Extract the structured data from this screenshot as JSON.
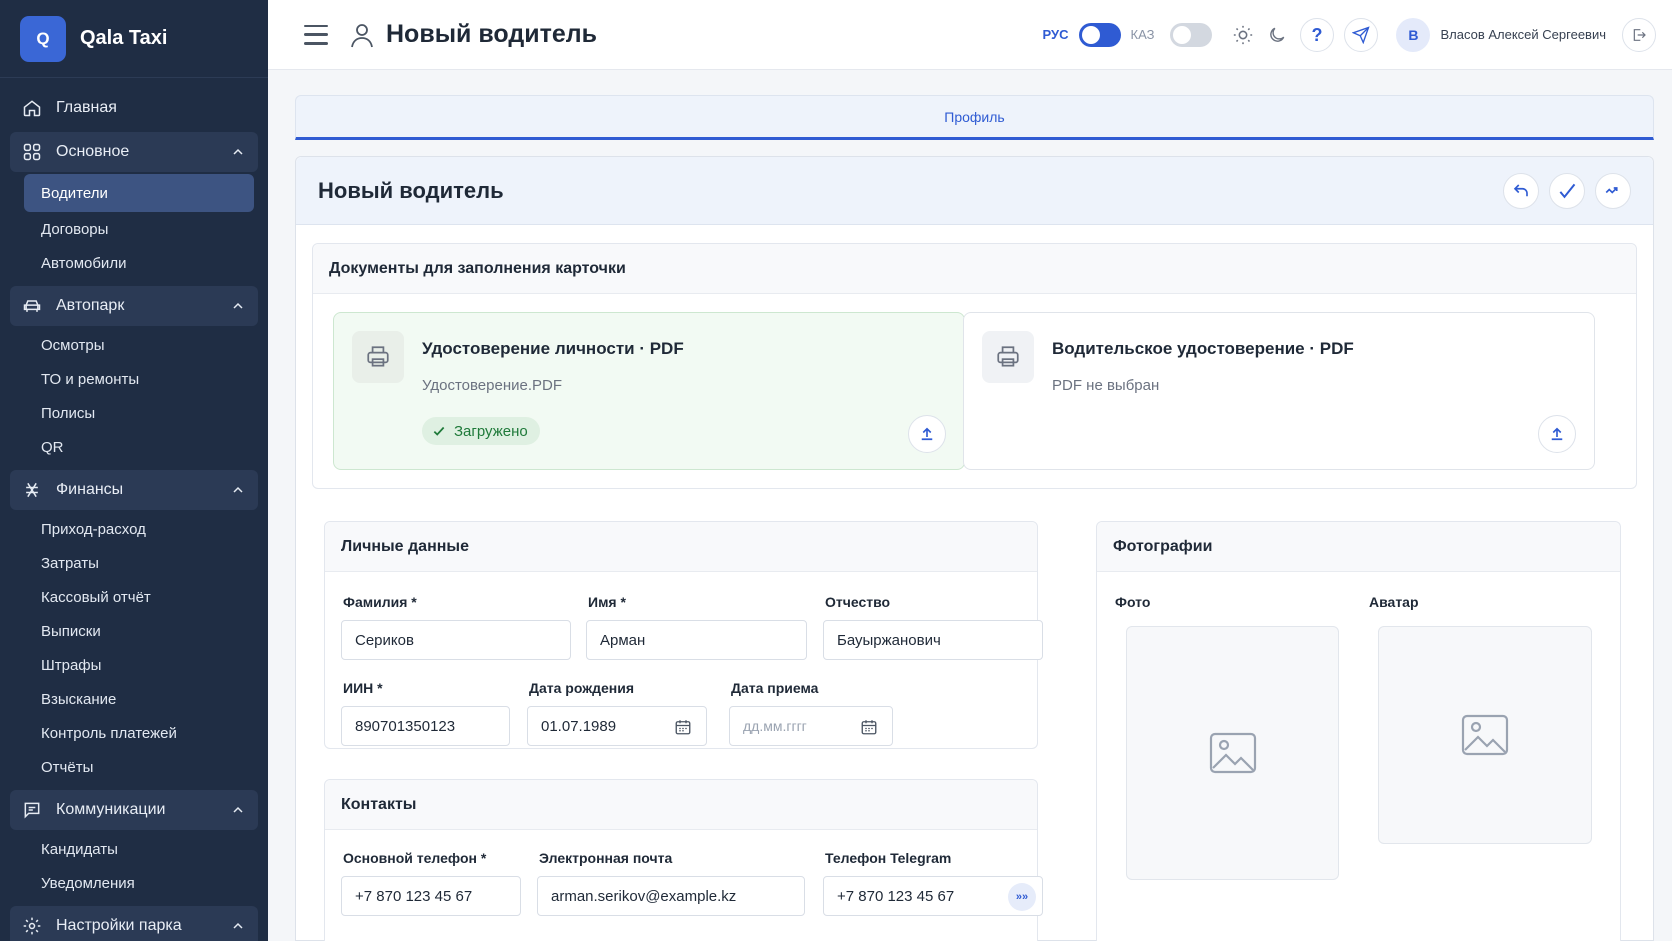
{
  "brand": {
    "logo_letter": "Q",
    "name": "Qala Taxi"
  },
  "sidebar": {
    "home": {
      "label": "Главная",
      "icon": "home-icon"
    },
    "groups": [
      {
        "label": "Основное",
        "icon": "grid-icon",
        "items": [
          "Водители",
          "Договоры",
          "Автомобили"
        ],
        "active": "Водители"
      },
      {
        "label": "Автопарк",
        "icon": "car-icon",
        "items": [
          "Осмотры",
          "ТО и ремонты",
          "Полисы",
          "QR"
        ]
      },
      {
        "label": "Финансы",
        "icon": "finance-icon",
        "items": [
          "Приход-расход",
          "Затраты",
          "Кассовый отчёт",
          "Выписки",
          "Штрафы",
          "Взыскание",
          "Контроль платежей",
          "Отчёты"
        ]
      },
      {
        "label": "Коммуникации",
        "icon": "chat-icon",
        "items": [
          "Кандидаты",
          "Уведомления"
        ]
      },
      {
        "label": "Настройки парка",
        "icon": "gear-icon",
        "items": []
      }
    ]
  },
  "header": {
    "title": "Новый водитель",
    "lang_ru": "РУС",
    "lang_kz": "КАЗ",
    "lang_toggle_on": true,
    "theme_toggle_on": false,
    "user_initial": "В",
    "user_name": "Власов Алексей Сергеевич"
  },
  "tabs": [
    {
      "label": "Профиль",
      "active": true
    }
  ],
  "card": {
    "title": "Новый водитель"
  },
  "documents": {
    "title": "Документы для заполнения карточки",
    "items": [
      {
        "title": "Удостоверение личности · PDF",
        "file": "Удостоверение.PDF",
        "status": "Загружено",
        "uploaded": true
      },
      {
        "title": "Водительское удостоверение · PDF",
        "file": "PDF не выбран",
        "status": "",
        "uploaded": false
      }
    ]
  },
  "personal": {
    "title": "Личные данные",
    "last_name": {
      "label": "Фамилия *",
      "value": "Сериков"
    },
    "first_name": {
      "label": "Имя *",
      "value": "Арман"
    },
    "middle_name": {
      "label": "Отчество",
      "value": "Бауыржанович"
    },
    "iin": {
      "label": "ИИН *",
      "value": "890701350123"
    },
    "birth_date": {
      "label": "Дата рождения",
      "value": "01.07.1989"
    },
    "hire_date": {
      "label": "Дата приема",
      "placeholder": "дд.мм.гггг"
    }
  },
  "contacts": {
    "title": "Контакты",
    "phone": {
      "label": "Основной телефон *",
      "value": "+7 870 123 45 67"
    },
    "email": {
      "label": "Электронная почта",
      "value": "arman.serikov@example.kz"
    },
    "telegram": {
      "label": "Телефон Telegram",
      "value": "+7 870 123 45 67",
      "button": "»»"
    }
  },
  "photos": {
    "title": "Фотографии",
    "photo_label": "Фото",
    "avatar_label": "Аватар"
  },
  "colors": {
    "accent": "#2f5bd3",
    "sidebar": "#1f2d44",
    "success": "#1f7a3a"
  }
}
